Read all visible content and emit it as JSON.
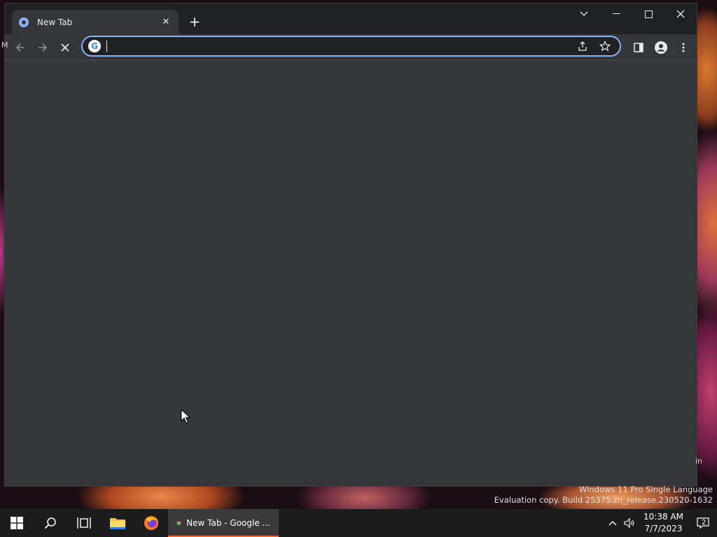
{
  "browser": {
    "tab": {
      "title": "New Tab"
    },
    "omnibox": {
      "value": "",
      "placeholder": ""
    }
  },
  "edge_text": {
    "left": "M",
    "right": "in"
  },
  "watermark": {
    "line1": "Windows 11 Pro Single Language",
    "line2": "Evaluation copy. Build 25375.zn_release.230520-1632"
  },
  "taskbar": {
    "chrome_task_label": "New Tab - Google ...",
    "clock_time": "10:38 AM",
    "clock_date": "7/7/2023",
    "notification_count": "2"
  }
}
